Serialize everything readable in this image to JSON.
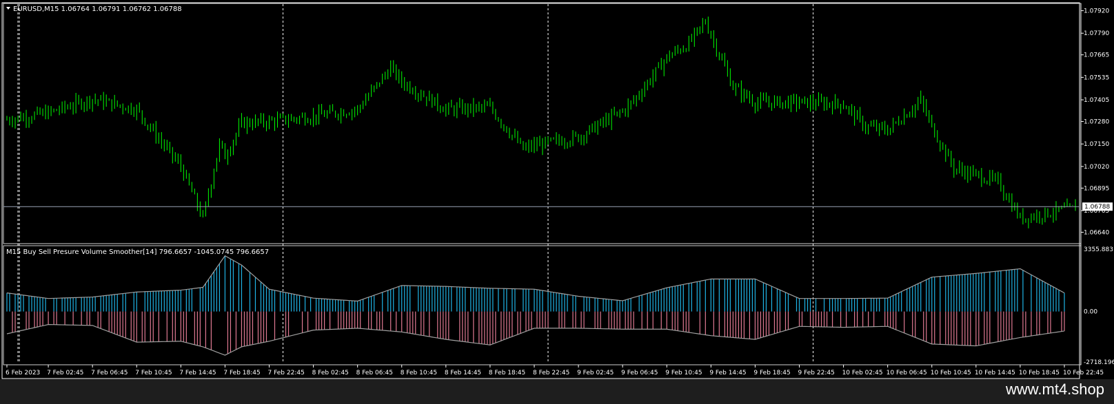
{
  "colors": {
    "background": "#000000",
    "candles": "#00ff00",
    "buy_histogram": "#1fb4e6",
    "sell_histogram": "#e07a93",
    "envelope": "#a0a0a0",
    "frame": "#ffffff",
    "grid": "#ffffff",
    "price_line": "#9aa3b5"
  },
  "header": {
    "symbol_line": "EURUSD,M15  1.06764 1.06791 1.06762 1.06788"
  },
  "indicator": {
    "title": "M15  Buy Sell Presure Volume Smoother[14] 796.6657 -1045.0745 796.6657"
  },
  "current_price_label": "1.06788",
  "watermark": "www.mt4.shop",
  "chart_data": [
    {
      "type": "candlestick",
      "title": "EURUSD,M15  1.06764 1.06791 1.06762 1.06788",
      "ylim": [
        1.0659,
        1.0795
      ],
      "y_ticks": [
        "1.07920",
        "1.07790",
        "1.07665",
        "1.07535",
        "1.07405",
        "1.07280",
        "1.07150",
        "1.07020",
        "1.06895",
        "1.06765",
        "1.06640"
      ],
      "x_ticks": [
        "6 Feb 2023",
        "7 Feb 02:45",
        "7 Feb 06:45",
        "7 Feb 10:45",
        "7 Feb 14:45",
        "7 Feb 18:45",
        "7 Feb 22:45",
        "8 Feb 02:45",
        "8 Feb 06:45",
        "8 Feb 10:45",
        "8 Feb 14:45",
        "8 Feb 18:45",
        "8 Feb 22:45",
        "9 Feb 02:45",
        "9 Feb 06:45",
        "9 Feb 10:45",
        "9 Feb 14:45",
        "9 Feb 18:45",
        "9 Feb 22:45",
        "10 Feb 02:45",
        "10 Feb 06:45",
        "10 Feb 10:45",
        "10 Feb 14:45",
        "10 Feb 18:45",
        "10 Feb 22:45"
      ],
      "current_price": 1.06788,
      "vertical_separators": [
        "7 Feb 00:00",
        "8 Feb 00:00",
        "9 Feb 00:00",
        "10 Feb 00:00"
      ],
      "series": [
        {
          "name": "close",
          "x": [
            "6 Feb 23:00",
            "7 Feb 02:45",
            "7 Feb 06:45",
            "7 Feb 10:45",
            "7 Feb 12:45",
            "7 Feb 14:45",
            "7 Feb 16:45",
            "7 Feb 18:15",
            "7 Feb 18:45",
            "7 Feb 20:15",
            "7 Feb 22:45",
            "8 Feb 02:45",
            "8 Feb 06:45",
            "8 Feb 09:45",
            "8 Feb 10:45",
            "8 Feb 14:45",
            "8 Feb 18:45",
            "8 Feb 21:45",
            "8 Feb 22:45",
            "9 Feb 02:45",
            "9 Feb 06:45",
            "9 Feb 07:45",
            "9 Feb 10:45",
            "9 Feb 12:45",
            "9 Feb 14:15",
            "9 Feb 14:45",
            "9 Feb 16:45",
            "9 Feb 18:45",
            "9 Feb 22:45",
            "10 Feb 02:45",
            "10 Feb 04:45",
            "10 Feb 06:45",
            "10 Feb 09:45",
            "10 Feb 10:45",
            "10 Feb 12:45",
            "10 Feb 14:45",
            "10 Feb 16:45",
            "10 Feb 18:45",
            "10 Feb 22:45",
            "10 Feb 23:45"
          ],
          "values": [
            1.0729,
            1.0733,
            1.0741,
            1.0735,
            1.0718,
            1.0702,
            1.0672,
            1.0715,
            1.0708,
            1.0727,
            1.0728,
            1.0731,
            1.0735,
            1.0759,
            1.0751,
            1.0735,
            1.0736,
            1.0712,
            1.0714,
            1.0719,
            1.0734,
            1.074,
            1.0765,
            1.0773,
            1.0786,
            1.0778,
            1.0748,
            1.0739,
            1.0739,
            1.0738,
            1.0725,
            1.0723,
            1.074,
            1.0725,
            1.0701,
            1.0697,
            1.0693,
            1.0672,
            1.0677,
            1.0678
          ]
        }
      ]
    },
    {
      "type": "bar",
      "title": "M15  Buy Sell Presure Volume Smoother[14] 796.6657 -1045.0745 796.6657",
      "ylim": [
        -2718.196,
        3355.883
      ],
      "y_ticks": [
        "3355.883",
        "0.00",
        "-2718.196"
      ],
      "series": [
        {
          "name": "",
          "x": [
            "6 Feb 23:00",
            "7 Feb 02:45",
            "7 Feb 06:45",
            "7 Feb 10:45",
            "7 Feb 14:45",
            "7 Feb 16:45",
            "7 Feb 18:45",
            "7 Feb 20:15",
            "7 Feb 22:45",
            "8 Feb 02:45",
            "8 Feb 06:45",
            "8 Feb 10:45",
            "8 Feb 14:45",
            "8 Feb 18:45",
            "8 Feb 22:45",
            "9 Feb 02:45",
            "9 Feb 06:45",
            "9 Feb 10:45",
            "9 Feb 14:45",
            "9 Feb 18:45",
            "9 Feb 22:45",
            "10 Feb 02:45",
            "10 Feb 06:45",
            "10 Feb 10:45",
            "10 Feb 14:45",
            "10 Feb 18:45",
            "10 Feb 22:45"
          ],
          "values": [
            1000,
            700,
            780,
            1050,
            1150,
            1300,
            3000,
            2500,
            1200,
            720,
            560,
            1400,
            1350,
            1250,
            1200,
            820,
            580,
            1280,
            1750,
            1750,
            700,
            700,
            720,
            1850,
            2050,
            2300,
            1000
          ]
        },
        {
          "name": "",
          "x": [
            "6 Feb 23:00",
            "7 Feb 02:45",
            "7 Feb 06:45",
            "7 Feb 10:45",
            "7 Feb 14:45",
            "7 Feb 16:45",
            "7 Feb 18:45",
            "7 Feb 20:15",
            "7 Feb 22:45",
            "8 Feb 02:45",
            "8 Feb 06:45",
            "8 Feb 10:45",
            "8 Feb 14:45",
            "8 Feb 18:45",
            "8 Feb 22:45",
            "9 Feb 02:45",
            "9 Feb 06:45",
            "9 Feb 10:45",
            "9 Feb 14:45",
            "9 Feb 18:45",
            "9 Feb 22:45",
            "10 Feb 02:45",
            "10 Feb 06:45",
            "10 Feb 10:45",
            "10 Feb 14:45",
            "10 Feb 18:45",
            "10 Feb 22:45"
          ],
          "values": [
            -1200,
            -700,
            -750,
            -1650,
            -1600,
            -1900,
            -2350,
            -1900,
            -1600,
            -1000,
            -900,
            -1100,
            -1500,
            -1800,
            -900,
            -900,
            -950,
            -950,
            -1300,
            -1500,
            -800,
            -850,
            -800,
            -1750,
            -1850,
            -1400,
            -1050
          ]
        }
      ]
    }
  ]
}
